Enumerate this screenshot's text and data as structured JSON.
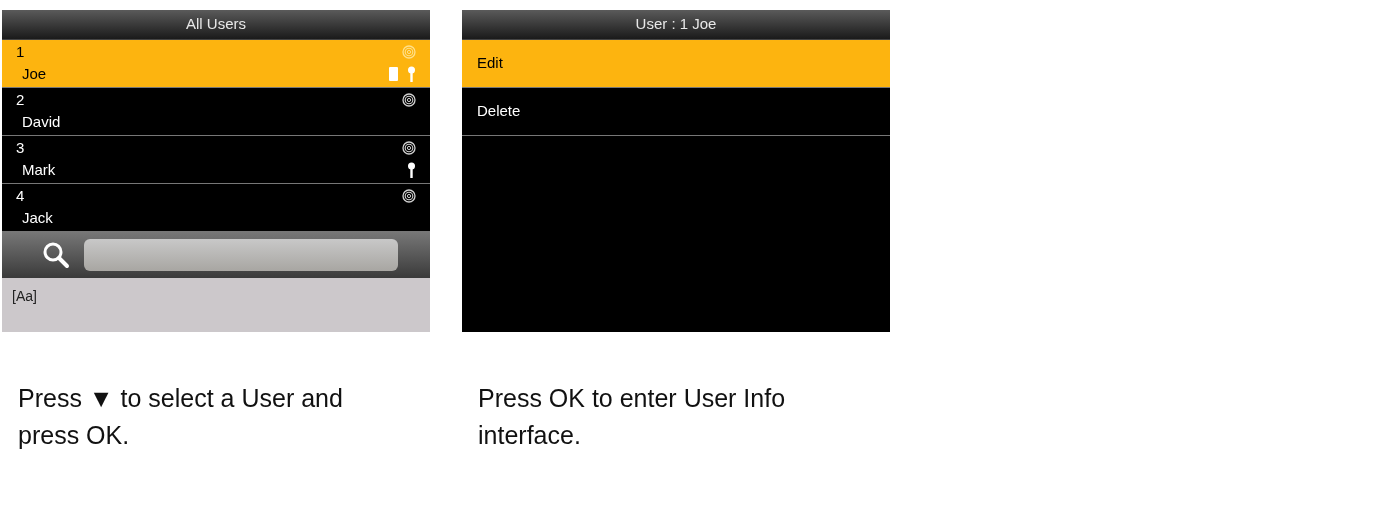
{
  "screens": [
    {
      "title": "All Users",
      "kind": "user-list",
      "users": [
        {
          "number": "1",
          "name": "Joe",
          "selected": true,
          "fingerprint": true,
          "card": true,
          "password": true
        },
        {
          "number": "2",
          "name": "David",
          "selected": false,
          "fingerprint": true,
          "card": false,
          "password": false
        },
        {
          "number": "3",
          "name": "Mark",
          "selected": false,
          "fingerprint": true,
          "card": false,
          "password": true
        },
        {
          "number": "4",
          "name": "Jack",
          "selected": false,
          "fingerprint": true,
          "card": false,
          "password": false
        }
      ],
      "input_mode": "[Aa]",
      "caption": "Press ▼ to select a User and press OK."
    },
    {
      "title": "User : 1 Joe",
      "kind": "menu",
      "items": [
        {
          "label": "Edit",
          "selected": true
        },
        {
          "label": "Delete",
          "selected": false
        }
      ],
      "caption": "Press OK to enter User Info interface."
    }
  ]
}
